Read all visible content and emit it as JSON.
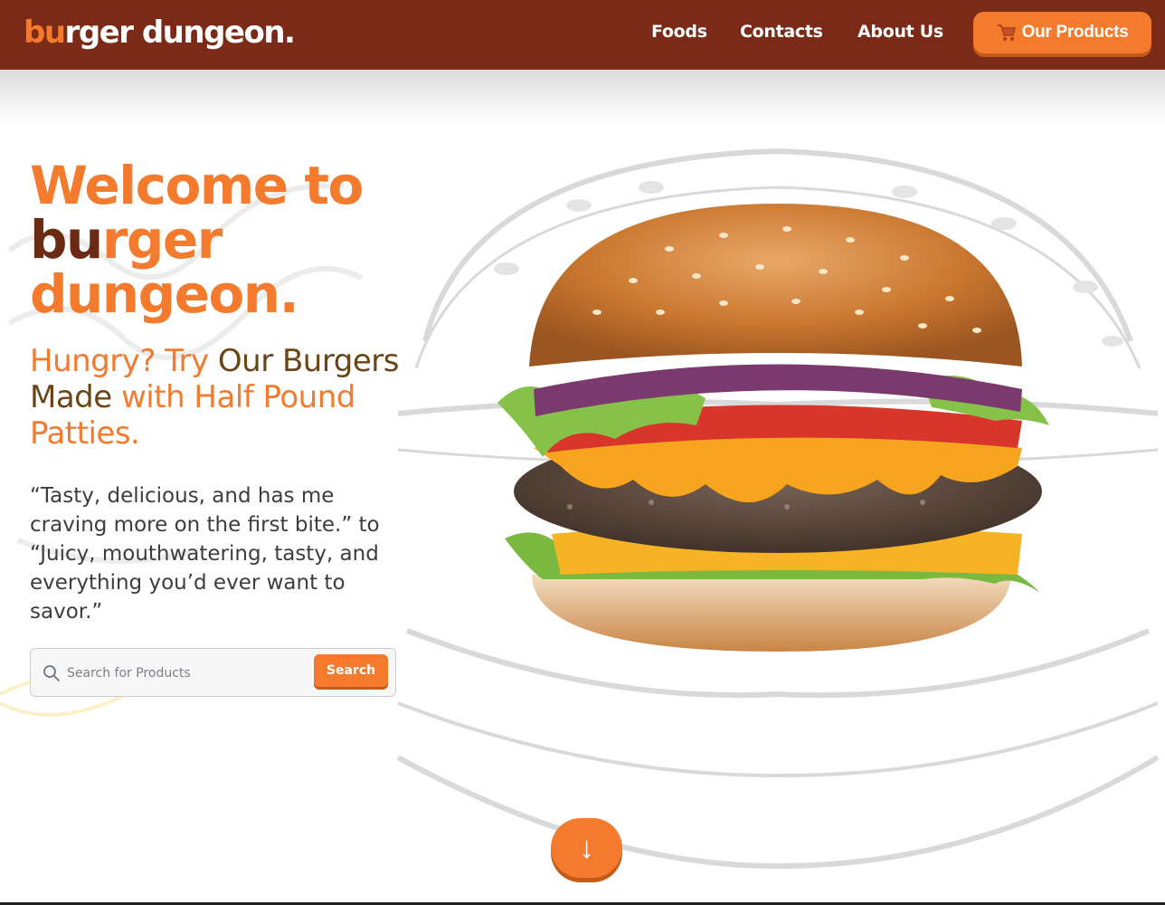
{
  "brand": {
    "logo_part1": "bu",
    "logo_part2": "rger dungeon."
  },
  "nav": {
    "links": [
      "Foods",
      "Contacts",
      "About Us"
    ],
    "products_label": "Our Products",
    "products_icon": "cart-icon"
  },
  "hero": {
    "title_line1": "Welcome to",
    "title_bu": "bu",
    "title_rger": "rger",
    "title_line3": "dungeon.",
    "sub_a": "Hungry? Try",
    "sub_b": " Our Burgers Made ",
    "sub_c": "with Half Pound Patties.",
    "quote": "“Tasty, delicious, and has me craving more on the first bite.” to “Juicy, mouthwatering, tasty, and everything you’d ever want to savor.”"
  },
  "search": {
    "placeholder": "Search for Products",
    "value": "",
    "button_label": "Search",
    "icon": "search-icon"
  },
  "scroll": {
    "label": "↓",
    "icon": "arrow-down-icon"
  },
  "colors": {
    "navbar": "#7a2a16",
    "accent": "#f47a2d",
    "dark_brown": "#6b2a14",
    "text": "#3d3d3d"
  }
}
